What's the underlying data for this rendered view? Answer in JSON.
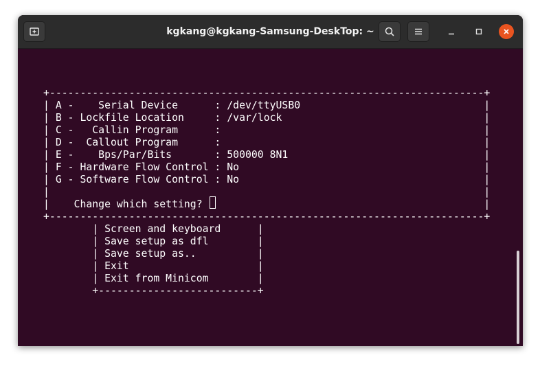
{
  "window": {
    "title": "kgkang@kgkang-Samsung-DeskTop: ~"
  },
  "icons": {
    "new_tab": "new-tab-icon",
    "search": "search-icon",
    "menu": "hamburger-menu-icon",
    "minimize": "minimize-icon",
    "maximize": "maximize-icon",
    "close": "close-icon"
  },
  "colors": {
    "terminal_bg": "#300a24",
    "titlebar_bg": "#2c2c2c",
    "close_accent": "#e95420",
    "text": "#ffffff"
  },
  "terminal": {
    "lines": [
      "+-----------------------------------------------------------------------+",
      "| A -    Serial Device      : /dev/ttyUSB0                              |",
      "| B - Lockfile Location     : /var/lock                                 |",
      "| C -   Callin Program      :                                           |",
      "| D -  Callout Program      :                                           |",
      "| E -    Bps/Par/Bits       : 500000 8N1                                |",
      "| F - Hardware Flow Control : No                                        |",
      "| G - Software Flow Control : No                                        |",
      "|                                                                       |",
      "|    Change which setting?                                              |",
      "+-----------------------------------------------------------------------+",
      "        | Screen and keyboard      |",
      "        | Save setup as dfl        |",
      "        | Save setup as..          |",
      "        | Exit                     |",
      "        | Exit from Minicom        |",
      "        +--------------------------+"
    ]
  }
}
